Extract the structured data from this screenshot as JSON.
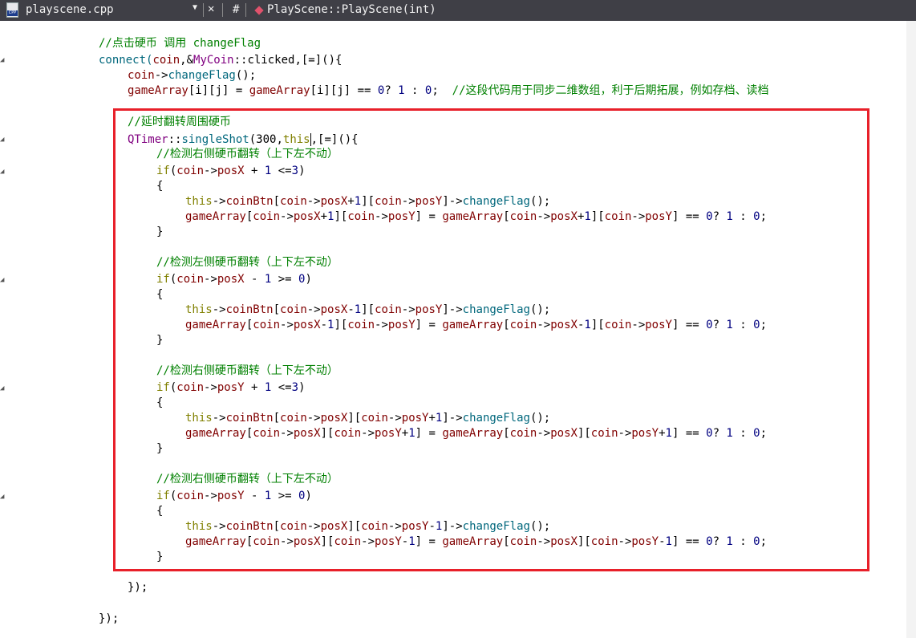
{
  "tab": {
    "filename": "playscene.cpp",
    "icon_label": "CPP",
    "hash": "#",
    "member": "PlayScene::PlayScene(int)",
    "dropdown": "▼",
    "close": "✕"
  },
  "code": {
    "c1": "//点击硬币 调用 changeFlag",
    "l2a": "connect(",
    "l2b": "coin",
    "l2c": ",&",
    "l2d": "MyCoin",
    "l2e": "::clicked,[=](){",
    "l3a": "coin",
    "l3b": "->",
    "l3c": "changeFlag",
    "l3d": "();",
    "l4a": "gameArray",
    "l4b": "[i][j] = ",
    "l4c": "gameArray",
    "l4d": "[i][j] == ",
    "l4e": "0",
    "l4f": "? ",
    "l4g": "1",
    "l4h": " : ",
    "l4i": "0",
    "l4j": ";  ",
    "c4": "//这段代码用于同步二维数组，利于后期拓展，例如存档、读档",
    "c5": "//延时翻转周围硬币",
    "l6a": "QTimer",
    "l6b": "::",
    "l6c": "singleShot",
    "l6d": "(300,",
    "l6e": "this",
    "l6f": ",[=](){",
    "c7": "//检测右侧硬币翻转（上下左不动）",
    "c8": "//检测左侧硬币翻转（上下左不动）",
    "if_kw": "if",
    "this_kw": "this",
    "coin": "coin",
    "coinBtn": "coinBtn",
    "posX": "posX",
    "posY": "posY",
    "gameArray": "gameArray",
    "changeFlag": "changeFlag",
    "open_brace": "{",
    "close_brace": "}",
    "timer_close": "});",
    "connect_close": "});"
  }
}
